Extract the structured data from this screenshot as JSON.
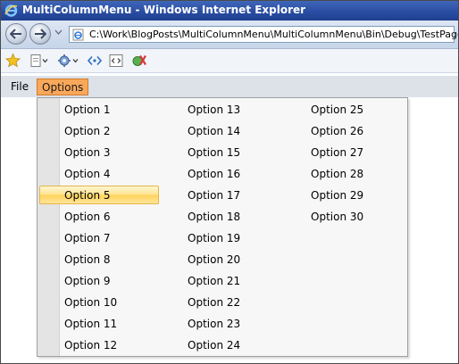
{
  "window": {
    "title": "MultiColumnMenu - Windows Internet Explorer"
  },
  "address_bar": {
    "url": "C:\\Work\\BlogPosts\\MultiColumnMenu\\MultiColumnMenu\\Bin\\Debug\\TestPage.html"
  },
  "toolbar": {
    "icons": [
      "favorites-star-icon",
      "page-menu-icon",
      "tools-menu-icon",
      "developer-tools-icon",
      "html-view-icon",
      "tools-plugin-icon"
    ]
  },
  "menubar": {
    "items": [
      {
        "label": "File"
      },
      {
        "label": "Options",
        "active": true
      }
    ]
  },
  "dropdown": {
    "highlighted": "Option 5",
    "columns": [
      [
        "Option 1",
        "Option 2",
        "Option 3",
        "Option 4",
        "Option 5",
        "Option 6",
        "Option 7",
        "Option 8",
        "Option 9",
        "Option 10",
        "Option 11",
        "Option 12"
      ],
      [
        "Option 13",
        "Option 14",
        "Option 15",
        "Option 16",
        "Option 17",
        "Option 18",
        "Option 19",
        "Option 20",
        "Option 21",
        "Option 22",
        "Option 23",
        "Option 24"
      ],
      [
        "Option 25",
        "Option 26",
        "Option 27",
        "Option 28",
        "Option 29",
        "Option 30"
      ]
    ]
  },
  "colors": {
    "active_menu": "#f9a85a",
    "highlight": "#ffe38c",
    "titlebar": "#2a4ea3"
  }
}
